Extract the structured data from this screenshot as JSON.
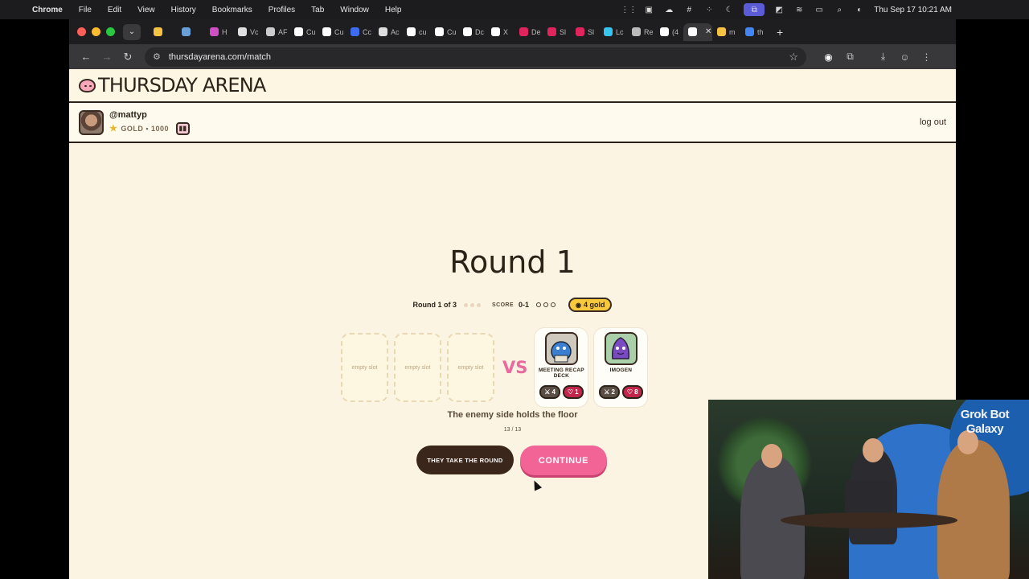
{
  "menubar": {
    "app": "Chrome",
    "items": [
      "File",
      "Edit",
      "View",
      "History",
      "Bookmarks",
      "Profiles",
      "Tab",
      "Window",
      "Help"
    ],
    "clock": "Thu Sep 17  10:21 AM"
  },
  "browser": {
    "tabs": [
      {
        "label": "",
        "color": "#f5c242"
      },
      {
        "label": "",
        "color": "#6aa0d8"
      },
      {
        "label": "H",
        "color": "#d04fc4"
      },
      {
        "label": "Vc",
        "color": "#e0e0e0"
      },
      {
        "label": "AF",
        "color": "#cccccc"
      },
      {
        "label": "Cu",
        "color": "#ffffff"
      },
      {
        "label": "Cu",
        "color": "#ffffff"
      },
      {
        "label": "Cc",
        "color": "#3d6cf0"
      },
      {
        "label": "Ac",
        "color": "#dddddd"
      },
      {
        "label": "cu",
        "color": "#ffffff"
      },
      {
        "label": "Cu",
        "color": "#ffffff"
      },
      {
        "label": "Dc",
        "color": "#ffffff"
      },
      {
        "label": "X",
        "color": "#ffffff"
      },
      {
        "label": "De",
        "color": "#e0245e"
      },
      {
        "label": "Sl",
        "color": "#e0245e"
      },
      {
        "label": "Sl",
        "color": "#e0245e"
      },
      {
        "label": "Lc",
        "color": "#36c5f0"
      },
      {
        "label": "Re",
        "color": "#bbbbbb"
      },
      {
        "label": "(4",
        "color": "#ffffff"
      },
      {
        "label": "",
        "color": "#ffffff",
        "active": true
      },
      {
        "label": "m",
        "color": "#f5c242"
      },
      {
        "label": "th",
        "color": "#4285f4"
      }
    ],
    "url": "thursdayarena.com/match"
  },
  "site": {
    "title": "THURSDAY ARENA",
    "user": {
      "handle": "@mattyp",
      "rank": "GOLD • 1000"
    },
    "logout": "log out"
  },
  "match": {
    "round_title": "Round 1",
    "round_progress": "Round 1 of 3",
    "score_label": "SCORE",
    "score": "0-1",
    "gold": "4 gold",
    "player_slots": [
      "empty slot",
      "empty slot",
      "empty slot"
    ],
    "vs": "VS",
    "enemy_cards": [
      {
        "name": "MEETING RECAP DECK",
        "attack": "4",
        "health": "1"
      },
      {
        "name": "IMOGEN",
        "attack": "2",
        "health": "8"
      }
    ],
    "status_text": "The enemy side holds the floor",
    "counter": "13 / 13",
    "buttons": {
      "result": "THEY TAKE THE ROUND",
      "continue": "CONTINUE"
    }
  },
  "webcam": {
    "caption": "Grok Bot Galaxy"
  }
}
